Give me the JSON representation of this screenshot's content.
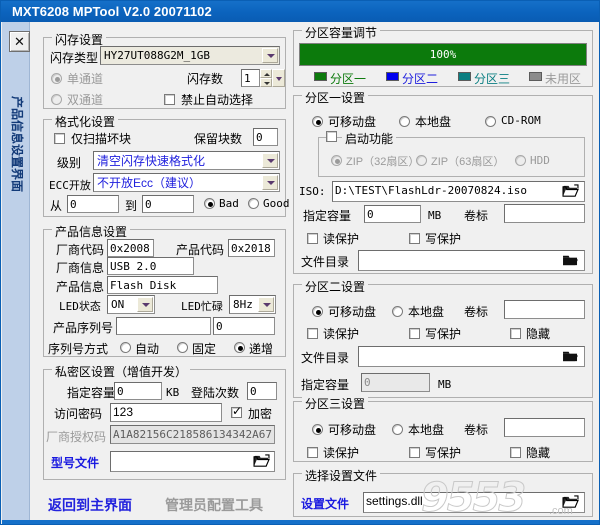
{
  "window": {
    "title": "MXT6208 MPTool V2.0 20071102",
    "close_label": "✕"
  },
  "sidebar": {
    "vertical_label": "产品信息设置界面"
  },
  "flash_settings": {
    "group_title": "闪存设置",
    "type_label": "闪存类型",
    "type_value": "HY27UT088G2M_1GB",
    "single_channel": "单通道",
    "dual_channel": "双通道",
    "count_label": "闪存数",
    "count_value": "1",
    "disable_auto_label": "禁止自动选择"
  },
  "format_settings": {
    "group_title": "格式化设置",
    "scan_bad_only": "仅扫描坏块",
    "reserve_blocks_label": "保留块数",
    "reserve_blocks_value": "0",
    "level_label": "级别",
    "level_value": "清空闪存快速格式化",
    "ecc_label": "ECC开放",
    "ecc_value": "不开放Ecc（建议）",
    "from_label": "从",
    "from_value": "0",
    "to_label": "到",
    "to_value": "0",
    "bad_label": "Bad",
    "good_label": "Good"
  },
  "product_info": {
    "group_title": "产品信息设置",
    "vendor_code_label": "厂商代码",
    "vendor_code_value": "0x2008",
    "product_code_label": "产品代码",
    "product_code_value": "0x2018",
    "vendor_info_label": "厂商信息",
    "vendor_info_value": "USB 2.0",
    "product_info_label": "产品信息",
    "product_info_value": "Flash Disk",
    "led_state_label": "LED状态",
    "led_state_value": "ON",
    "led_busy_label": "LED忙碌",
    "led_busy_value": "8Hz",
    "serial_label": "产品序列号",
    "serial_value": "",
    "serial_start_value": "0",
    "serial_mode_label": "序列号方式",
    "serial_mode_auto": "自动",
    "serial_mode_fixed": "固定",
    "serial_mode_increment": "递增"
  },
  "private_area": {
    "group_title": "私密区设置（增值开发）",
    "capacity_label": "指定容量",
    "capacity_value": "0",
    "capacity_unit": "KB",
    "login_count_label": "登陆次数",
    "login_count_value": "0",
    "password_label": "访问密码",
    "password_value": "123",
    "encrypt_label": "加密",
    "auth_code_label": "厂商授权码",
    "auth_code_value": "A1A82156C218586134342A67",
    "model_file_label": "型号文件",
    "model_file_value": ""
  },
  "bottom_links": {
    "back_to_main": "返回到主界面",
    "admin_config_tool": "管理员配置工具"
  },
  "partition_capacity": {
    "group_title": "分区容量调节",
    "bar_text": "100%",
    "bar_percent": 100,
    "legend": [
      {
        "name": "分区一",
        "color": "#0c7a0c",
        "text_color": "#0c7a0c"
      },
      {
        "name": "分区二",
        "color": "#0000ee",
        "text_color": "#2020dd"
      },
      {
        "name": "分区三",
        "color": "#0b7f82",
        "text_color": "#0b7f82"
      },
      {
        "name": "未用区",
        "color": "#8c8c8c",
        "text_color": "#9a9a9a"
      }
    ]
  },
  "partition1": {
    "group_title": "分区一设置",
    "removable": "可移动盘",
    "local": "本地盘",
    "cdrom": "CD-ROM",
    "boot_group_title": "启动功能",
    "zip32": "ZIP（32扇区）",
    "zip63": "ZIP（63扇区）",
    "hdd": "HDD",
    "iso_label": "ISO:",
    "iso_value": "D:\\TEST\\FlashLdr-20070824.iso",
    "capacity_label": "指定容量",
    "capacity_value": "0",
    "capacity_unit": "MB",
    "volume_label": "卷标",
    "volume_value": "",
    "read_protect": "读保护",
    "write_protect": "写保护",
    "file_dir_label": "文件目录",
    "file_dir_value": ""
  },
  "partition2": {
    "group_title": "分区二设置",
    "removable": "可移动盘",
    "local": "本地盘",
    "volume_label": "卷标",
    "volume_value": "",
    "read_protect": "读保护",
    "write_protect": "写保护",
    "hidden": "隐藏",
    "file_dir_label": "文件目录",
    "file_dir_value": "",
    "capacity_label": "指定容量",
    "capacity_value": "0",
    "capacity_unit": "MB"
  },
  "partition3": {
    "group_title": "分区三设置",
    "removable": "可移动盘",
    "local": "本地盘",
    "volume_label": "卷标",
    "volume_value": "",
    "read_protect": "读保护",
    "write_protect": "写保护",
    "hidden": "隐藏"
  },
  "settings_file": {
    "group_title": "选择设置文件",
    "label": "设置文件",
    "value": "settings.dll"
  },
  "watermark": {
    "text": "9553",
    "suffix": ".com"
  }
}
